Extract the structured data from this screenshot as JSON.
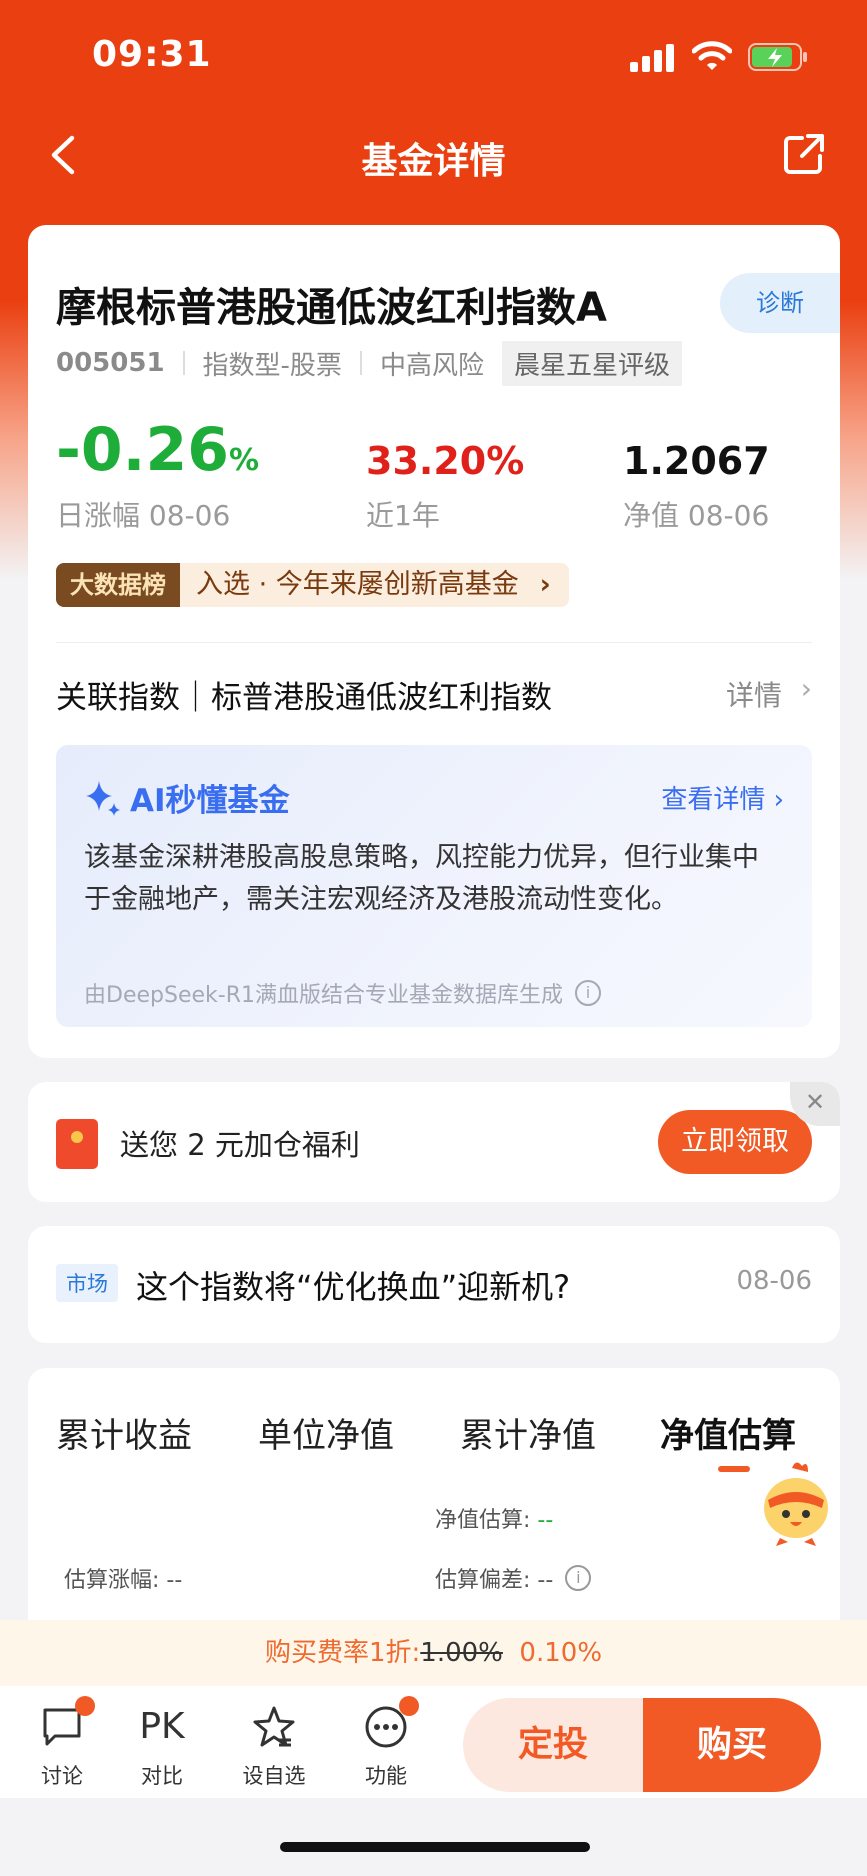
{
  "status_bar": {
    "time": "09:31"
  },
  "nav": {
    "title": "基金详情"
  },
  "fund": {
    "name": "摩根标普港股通低波红利指数A",
    "diagnose_label": "诊断",
    "code": "005051",
    "type": "指数型-股票",
    "risk": "中高风险",
    "rating": "晨星五星评级",
    "daily_change_value": "-0.26",
    "daily_change_unit": "%",
    "daily_change_label": "日涨幅 08-06",
    "year_return_value": "33.20%",
    "year_return_label": "近1年",
    "nav_value": "1.2067",
    "nav_label": "净值 08-06",
    "bigdata_tag": "大数据榜",
    "bigdata_text": "入选 · 今年来屡创新高基金",
    "assoc_index_label": "关联指数｜标普港股通低波红利指数",
    "assoc_detail": "详情"
  },
  "ai": {
    "title": "AI秒懂基金",
    "more": "查看详情",
    "text": "该基金深耕港股高股息策略，风控能力优异，但行业集中于金融地产，需关注宏观经济及港股流动性变化。",
    "footer": "由DeepSeek-R1满血版结合专业基金数据库生成"
  },
  "welfare": {
    "text": "送您 2 元加仓福利",
    "button": "立即领取"
  },
  "news": {
    "tag": "市场",
    "title": "这个指数将“优化换血”迎新机?",
    "date": "08-06"
  },
  "tabs": {
    "t1": "累计收益",
    "t2": "单位净值",
    "t3": "累计净值",
    "t4": "净值估算"
  },
  "estimate": {
    "nav_est_label": "净值估算: ",
    "nav_est_value": "--",
    "change_label": "估算涨幅: --",
    "deviation_label": "估算偏差: --"
  },
  "fee": {
    "prefix": "购买费率1折:",
    "old": "1.00%",
    "new": "0.10%"
  },
  "bottom": {
    "discuss": "讨论",
    "pk": "PK",
    "compare": "对比",
    "watch": "设自选",
    "function": "功能",
    "fixed_invest": "定投",
    "buy": "购买"
  },
  "colors": {
    "brand": "#ea3f10",
    "up": "#e0211a",
    "down": "#1fad3a",
    "ai_blue": "#3a6ef0"
  }
}
